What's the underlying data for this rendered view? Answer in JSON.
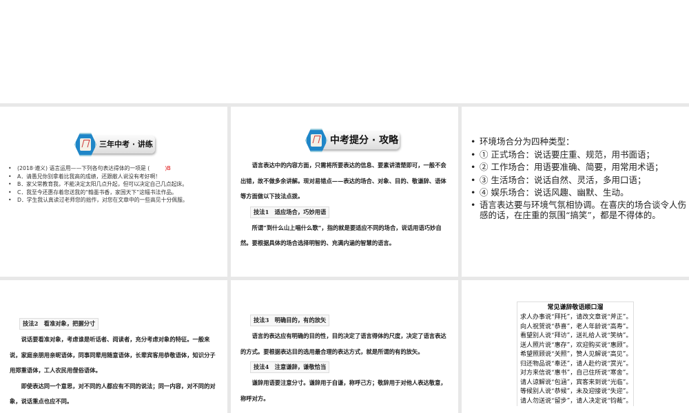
{
  "slides": [
    {
      "badge": "三年中考 · 讲练",
      "bullets": [
        "(2018·遵义) 语言运用——下列各句表达得体的一项是 (",
        "A．请愚兄你别拿着比我高的成绩，还跟敝人说没有考好啊！",
        "B．家父常教育我，不能决定太阳几点升起，但可以决定自己几点起床。",
        "C．我至今还惠存着您送我的“翰墨书香，家国天下”这幅书法作品。",
        "D．学生我认真读过老师您的拙作，对您在文章中的一些高见十分佩服。"
      ],
      "answer": ")B"
    },
    {
      "badge": "中考提分 · 攻略",
      "intro": "语言表达中的内容方面，只需将所要表达的信息、要素讲清楚即可，一般不会出错，故不做多余讲解。现对易错点——表达的场合、对象、目的、敬谦辞、语体等方面做以下技法点拨。",
      "tip": "技法1　适应场合，巧妙用语",
      "body": "所谓“到什么山上唱什么歌”，指的就是要适应不同的场合，说话用语巧妙自然。要根据具体的场合选择明智的、充满内涵的智慧的语言。"
    },
    {
      "bullets": [
        "环境场合分为四种类型：",
        "① 正式场合：说话要庄重、规范，用书面语；",
        "② 工作场合：用语要准确、简要，用常用术语；",
        "③ 生活场合：说话自然、灵活，多用口语；",
        "④ 娱乐场合：说话风趣、幽默、生动。",
        "语言表达要与环境气氛相协调。在喜庆的场合谈令人伤感的话，在庄重的氛围“搞笑”，都是不得体的。"
      ]
    },
    {
      "tip": "技法2　看准对象，把握分寸",
      "p1": "说话要看准对象，考虑谁是听话者、阅读者，充分考虑对象的特征。一般来说，家庭亲朋用亲昵语体，同事同辈用随意语体，长辈宾客用恭敬语体，知识分子用郑重语体，工人农民用俚俗语体。",
      "p2": "即使表达同一个意思，对不同的人都应有不同的说法；同一内容，对不同的对象，说话重点也应不同。"
    },
    {
      "tip": "技法3　明确目的，有的放矢",
      "p1": "语言的表达应有明确的目的性，目的决定了语言得体的尺度，决定了语言表达的方式。要根据表达目的选用最合理的表达方式，就是所谓的有的放矢。",
      "tip2": "技法4　注意谦辞，谦敬恰当",
      "p2": "谦辞用语要注意分寸。谦辞用于自谦，称呼己方；敬辞用于对他人表达敬意，称呼对方。"
    },
    {
      "title": "常见谦辞敬语顺口溜",
      "rows": [
        "求人办事说“拜托”，请改文章说“斧正”。",
        "向人祝贺说“恭喜”，老人年龄说“高寿”。",
        "看望别人说“拜访”，送礼给人说“笑纳”。",
        "送人照片说“惠存”，欢迎购买说“惠顾”。",
        "希望照顾说“关照”，赞人见解说“高见”。",
        "归还物品说“奉还”，请人赴约说“赏光”。",
        "对方来信说“惠书”，自己住所说“寒舍”。",
        "请人谅解说“包涵”，宾客来到说“光临”。",
        "等候别人说“恭候”，未及迎接说“失迎”。",
        "请人勿送说“留步”，请人决定说“钧裁”。"
      ]
    }
  ]
}
